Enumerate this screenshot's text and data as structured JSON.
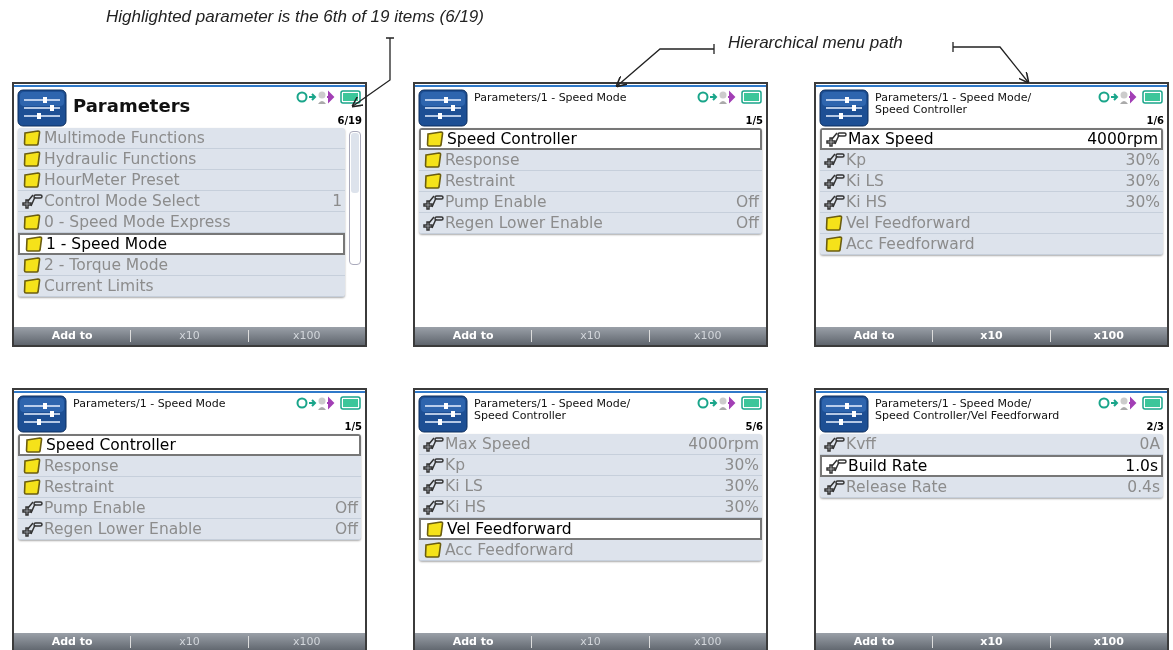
{
  "annotations": [
    {
      "text": "Highlighted parameter is the 6th of 19 items (6/19)"
    },
    {
      "text": "Hierarchical menu path"
    }
  ],
  "screens": [
    {
      "header": {
        "kind": "title",
        "lines": [
          "Parameters"
        ]
      },
      "counter": "6/19",
      "scrollbar": true,
      "items": [
        {
          "kind": "folder",
          "label": "Multimode Functions",
          "selected": false
        },
        {
          "kind": "folder",
          "label": "Hydraulic Functions",
          "selected": false
        },
        {
          "kind": "folder",
          "label": "HourMeter Preset",
          "selected": false
        },
        {
          "kind": "parameter",
          "label": "Control Mode Select",
          "value": "1",
          "selected": false
        },
        {
          "kind": "folder",
          "label": "0 - Speed Mode Express",
          "selected": false
        },
        {
          "kind": "folder",
          "label": "1 - Speed Mode",
          "selected": true
        },
        {
          "kind": "folder",
          "label": "2 - Torque Mode",
          "selected": false
        },
        {
          "kind": "folder",
          "label": "Current Limits",
          "selected": false
        }
      ],
      "softkeys": [
        {
          "label": "Add to",
          "disabled": false
        },
        {
          "label": "x10",
          "disabled": true
        },
        {
          "label": "x100",
          "disabled": true
        }
      ]
    },
    {
      "header": {
        "kind": "path",
        "lines": [
          "Parameters/1 - Speed Mode"
        ]
      },
      "counter": "1/5",
      "scrollbar": false,
      "items": [
        {
          "kind": "folder",
          "label": "Speed Controller",
          "selected": true
        },
        {
          "kind": "folder",
          "label": "Response",
          "selected": false
        },
        {
          "kind": "folder",
          "label": "Restraint",
          "selected": false
        },
        {
          "kind": "parameter",
          "label": "Pump Enable",
          "value": "Off",
          "selected": false
        },
        {
          "kind": "parameter",
          "label": "Regen Lower Enable",
          "value": "Off",
          "selected": false
        }
      ],
      "softkeys": [
        {
          "label": "Add to",
          "disabled": false
        },
        {
          "label": "x10",
          "disabled": true
        },
        {
          "label": "x100",
          "disabled": true
        }
      ]
    },
    {
      "header": {
        "kind": "path",
        "lines": [
          "Parameters/1 - Speed Mode/",
          "Speed Controller"
        ]
      },
      "counter": "1/6",
      "scrollbar": false,
      "items": [
        {
          "kind": "parameter",
          "label": "Max Speed",
          "value": "4000rpm",
          "selected": true
        },
        {
          "kind": "parameter",
          "label": "Kp",
          "value": "30%",
          "selected": false
        },
        {
          "kind": "parameter",
          "label": "Ki LS",
          "value": "30%",
          "selected": false
        },
        {
          "kind": "parameter",
          "label": "Ki HS",
          "value": "30%",
          "selected": false
        },
        {
          "kind": "folder",
          "label": "Vel Feedforward",
          "selected": false
        },
        {
          "kind": "folder",
          "label": "Acc Feedforward",
          "selected": false
        }
      ],
      "softkeys": [
        {
          "label": "Add to",
          "disabled": false
        },
        {
          "label": "x10",
          "disabled": false
        },
        {
          "label": "x100",
          "disabled": false
        }
      ]
    },
    {
      "header": {
        "kind": "path",
        "lines": [
          "Parameters/1 - Speed Mode"
        ]
      },
      "counter": "1/5",
      "scrollbar": false,
      "items": [
        {
          "kind": "folder",
          "label": "Speed Controller",
          "selected": true
        },
        {
          "kind": "folder",
          "label": "Response",
          "selected": false
        },
        {
          "kind": "folder",
          "label": "Restraint",
          "selected": false
        },
        {
          "kind": "parameter",
          "label": "Pump Enable",
          "value": "Off",
          "selected": false
        },
        {
          "kind": "parameter",
          "label": "Regen Lower Enable",
          "value": "Off",
          "selected": false
        }
      ],
      "softkeys": [
        {
          "label": "Add to",
          "disabled": false
        },
        {
          "label": "x10",
          "disabled": true
        },
        {
          "label": "x100",
          "disabled": true
        }
      ]
    },
    {
      "header": {
        "kind": "path",
        "lines": [
          "Parameters/1 - Speed Mode/",
          "Speed Controller"
        ]
      },
      "counter": "5/6",
      "scrollbar": false,
      "items": [
        {
          "kind": "parameter",
          "label": "Max Speed",
          "value": "4000rpm",
          "selected": false
        },
        {
          "kind": "parameter",
          "label": "Kp",
          "value": "30%",
          "selected": false
        },
        {
          "kind": "parameter",
          "label": "Ki LS",
          "value": "30%",
          "selected": false
        },
        {
          "kind": "parameter",
          "label": "Ki HS",
          "value": "30%",
          "selected": false
        },
        {
          "kind": "folder",
          "label": "Vel Feedforward",
          "selected": true
        },
        {
          "kind": "folder",
          "label": "Acc Feedforward",
          "selected": false
        }
      ],
      "softkeys": [
        {
          "label": "Add to",
          "disabled": false
        },
        {
          "label": "x10",
          "disabled": true
        },
        {
          "label": "x100",
          "disabled": true
        }
      ]
    },
    {
      "header": {
        "kind": "path",
        "lines": [
          "Parameters/1 - Speed Mode/",
          "Speed Controller/Vel Feedforward"
        ]
      },
      "counter": "2/3",
      "scrollbar": false,
      "items": [
        {
          "kind": "parameter",
          "label": "Kvff",
          "value": "0A",
          "selected": false
        },
        {
          "kind": "parameter",
          "label": "Build Rate",
          "value": "1.0s",
          "selected": true
        },
        {
          "kind": "parameter",
          "label": "Release Rate",
          "value": "0.4s",
          "selected": false
        }
      ],
      "softkeys": [
        {
          "label": "Add to",
          "disabled": false
        },
        {
          "label": "x10",
          "disabled": false
        },
        {
          "label": "x100",
          "disabled": false
        }
      ]
    }
  ]
}
